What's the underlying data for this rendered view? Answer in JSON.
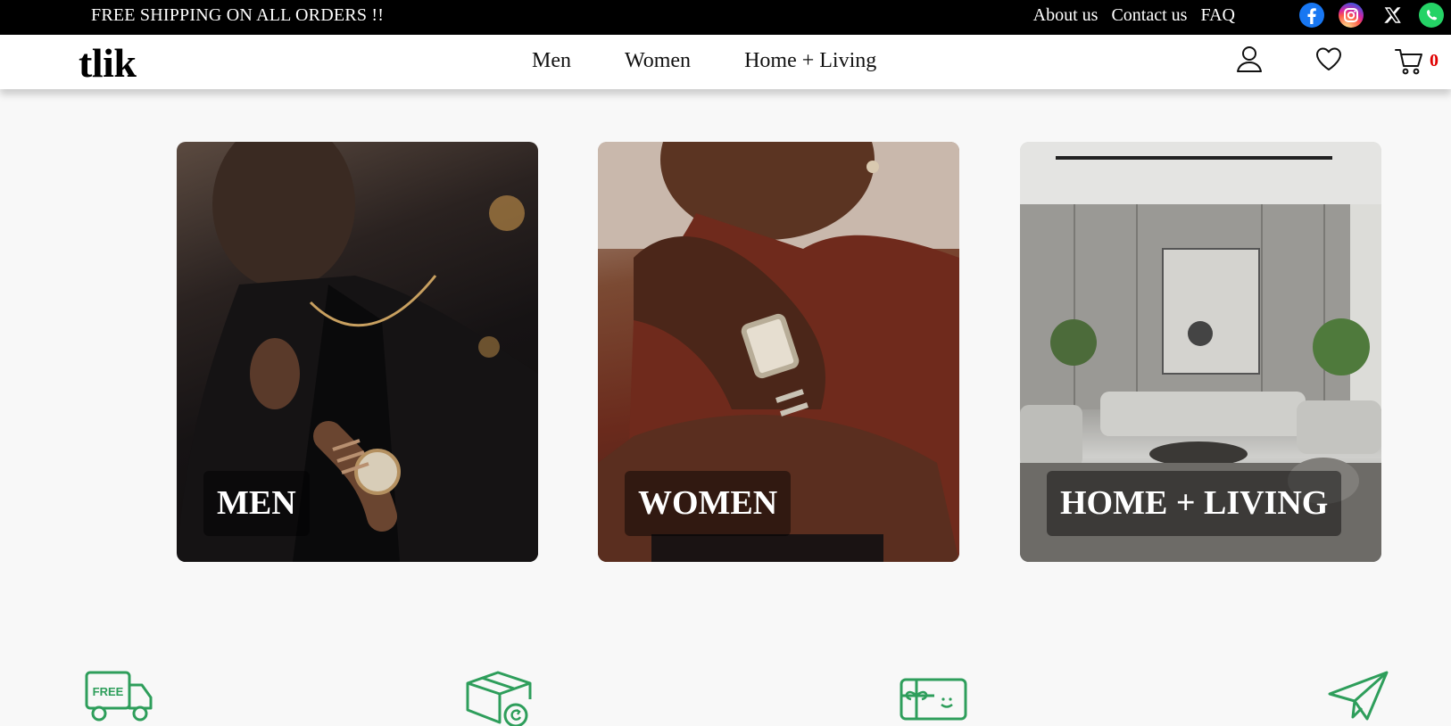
{
  "topbar": {
    "promo": "FREE SHIPPING ON ALL ORDERS !!",
    "links": [
      "About us",
      "Contact us",
      "FAQ"
    ],
    "social": [
      {
        "icon": "facebook-icon",
        "color": "#1877f2"
      },
      {
        "icon": "instagram-icon",
        "color": "#d6249f"
      },
      {
        "icon": "x-twitter-icon",
        "color": "#ffffff"
      },
      {
        "icon": "whatsapp-icon",
        "color": "#25d366"
      }
    ]
  },
  "header": {
    "logo": "tlik",
    "nav": [
      "Men",
      "Women",
      "Home + Living"
    ],
    "icons": [
      "user-icon",
      "heart-icon",
      "cart-icon"
    ],
    "cart_count": "0",
    "cart_count_color": "#e00000"
  },
  "categories": [
    {
      "label": "MEN"
    },
    {
      "label": "WOMEN"
    },
    {
      "label": "HOME + LIVING"
    }
  ],
  "features": {
    "icons": [
      "free-shipping-truck-icon",
      "return-box-icon",
      "gift-card-icon",
      "paper-plane-icon"
    ],
    "truck_badge": "FREE",
    "accent": "#2e9e5b"
  }
}
